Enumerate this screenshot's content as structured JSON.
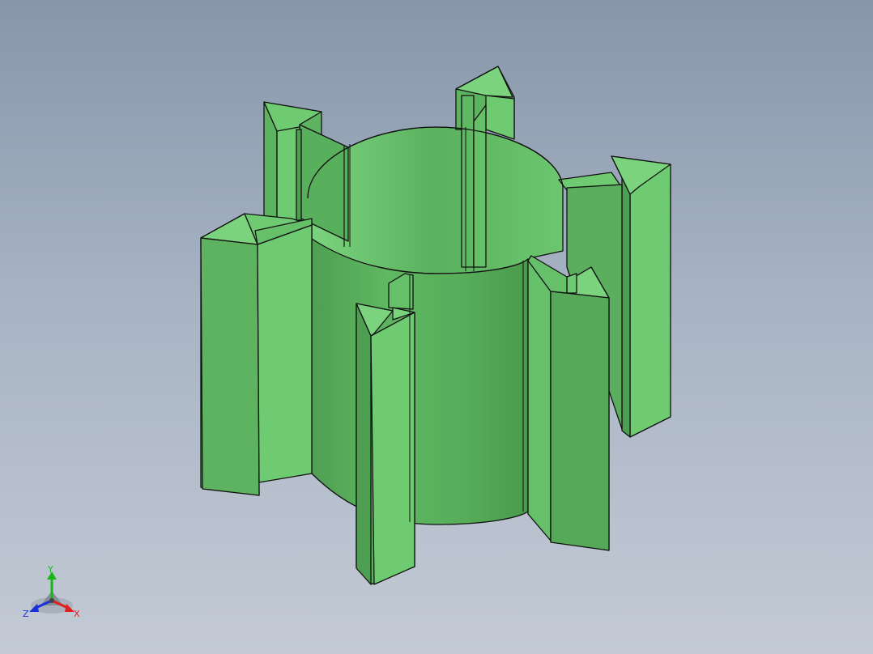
{
  "viewport": {
    "background_top": "#8796ab",
    "background_bottom": "#c3cad5"
  },
  "model": {
    "part_color": "#5db35f",
    "part_color_light": "#6fcb72",
    "part_color_dark": "#4f9f52",
    "edge_color": "#111111",
    "fins": 6
  },
  "triad": {
    "x_label": "X",
    "y_label": "Y",
    "z_label": "Z",
    "x_color": "#e02020",
    "y_color": "#18b418",
    "z_color": "#1a2fd8",
    "icon": "coordinate-triad-icon"
  }
}
